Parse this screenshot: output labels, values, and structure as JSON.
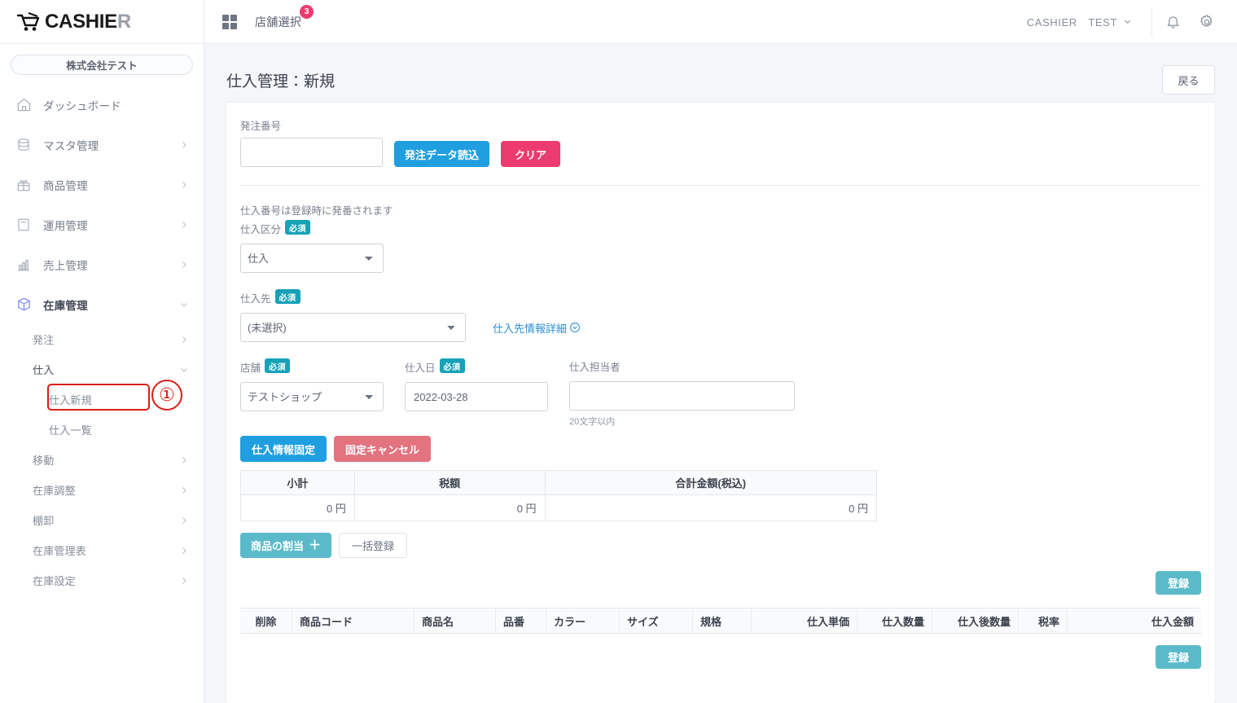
{
  "brand": {
    "name_main": "CASHIE",
    "name_tail": "R",
    "cart_icon": "shopping-cart-icon"
  },
  "sidebar": {
    "company": "株式会社テスト",
    "items": [
      {
        "label": "ダッシュボード",
        "icon": "home-icon",
        "chevron": false
      },
      {
        "label": "マスタ管理",
        "icon": "database-icon",
        "chevron": true
      },
      {
        "label": "商品管理",
        "icon": "gift-icon",
        "chevron": true
      },
      {
        "label": "運用管理",
        "icon": "clipboard-icon",
        "chevron": true
      },
      {
        "label": "売上管理",
        "icon": "bar-chart-icon",
        "chevron": true
      },
      {
        "label": "在庫管理",
        "icon": "box-icon",
        "chevron": true,
        "expanded": true
      }
    ],
    "sub_items": [
      {
        "label": "発注",
        "chevron": "right"
      },
      {
        "label": "仕入",
        "chevron": "down",
        "expanded": true
      }
    ],
    "sub_items2": [
      {
        "label": "仕入新規",
        "active": true
      },
      {
        "label": "仕入一覧",
        "active": false
      }
    ],
    "sub_items_rest": [
      {
        "label": "移動",
        "chevron": "right"
      },
      {
        "label": "在庫調整",
        "chevron": "right"
      },
      {
        "label": "棚卸",
        "chevron": "right"
      },
      {
        "label": "在庫管理表",
        "chevron": "right"
      },
      {
        "label": "在庫設定",
        "chevron": "right"
      }
    ]
  },
  "annotation": {
    "number": "①",
    "color": "#d91f14",
    "target": "仕入新規"
  },
  "topbar": {
    "grid_icon": "apps-grid-icon",
    "shop_select_label": "店舗選択",
    "shop_badge": "3",
    "user_name": "CASHIER　TEST",
    "user_chevron": "chevron-down-icon",
    "bell_icon": "bell-icon",
    "gear_icon": "gear-icon"
  },
  "page": {
    "title": "仕入管理：新規",
    "back_button": "戻る"
  },
  "form": {
    "order_no_label": "発注番号",
    "order_no_value": "",
    "btn_load_order": "発注データ読込",
    "btn_clear": "クリア",
    "notice": "仕入番号は登録時に発番されます",
    "kubun_label": "仕入区分",
    "kubun_required": "必須",
    "kubun_value": "仕入",
    "kubun_options": [
      "仕入"
    ],
    "supplier_label": "仕入先",
    "supplier_required": "必須",
    "supplier_value": "(未選択)",
    "supplier_options": [
      "(未選択)"
    ],
    "supplier_detail_link": "仕入先情報詳細",
    "supplier_detail_icon": "circle-chevron-down-icon",
    "shop_label": "店舗",
    "shop_required": "必須",
    "shop_value": "テストショップ",
    "shop_options": [
      "テストショップ"
    ],
    "date_label": "仕入日",
    "date_required": "必須",
    "date_value": "2022-03-28",
    "staff_label": "仕入担当者",
    "staff_value": "",
    "staff_hint": "20文字以内",
    "btn_fix": "仕入情報固定",
    "btn_fix_cancel": "固定キャンセル",
    "btn_assign": "商品の割当",
    "btn_assign_icon": "plus-icon",
    "btn_bulk": "一括登録",
    "btn_register": "登録"
  },
  "totals_table": {
    "headers": [
      "小計",
      "税額",
      "合計金額(税込)"
    ],
    "row": [
      "0 円",
      "0 円",
      "0 円"
    ]
  },
  "items_table": {
    "headers": [
      "削除",
      "商品コード",
      "商品名",
      "品番",
      "カラー",
      "サイズ",
      "規格",
      "仕入単価",
      "仕入数量",
      "仕入後数量",
      "税率",
      "仕入金額"
    ],
    "rows": []
  },
  "colors": {
    "blue": "#209fe0",
    "pink": "#ec3c6f",
    "teal": "#5bbac9",
    "required_badge": "#17a2b8",
    "red_cancel": "#e2737f",
    "link": "#2e8fd6",
    "annotation_red": "#d91f14"
  }
}
